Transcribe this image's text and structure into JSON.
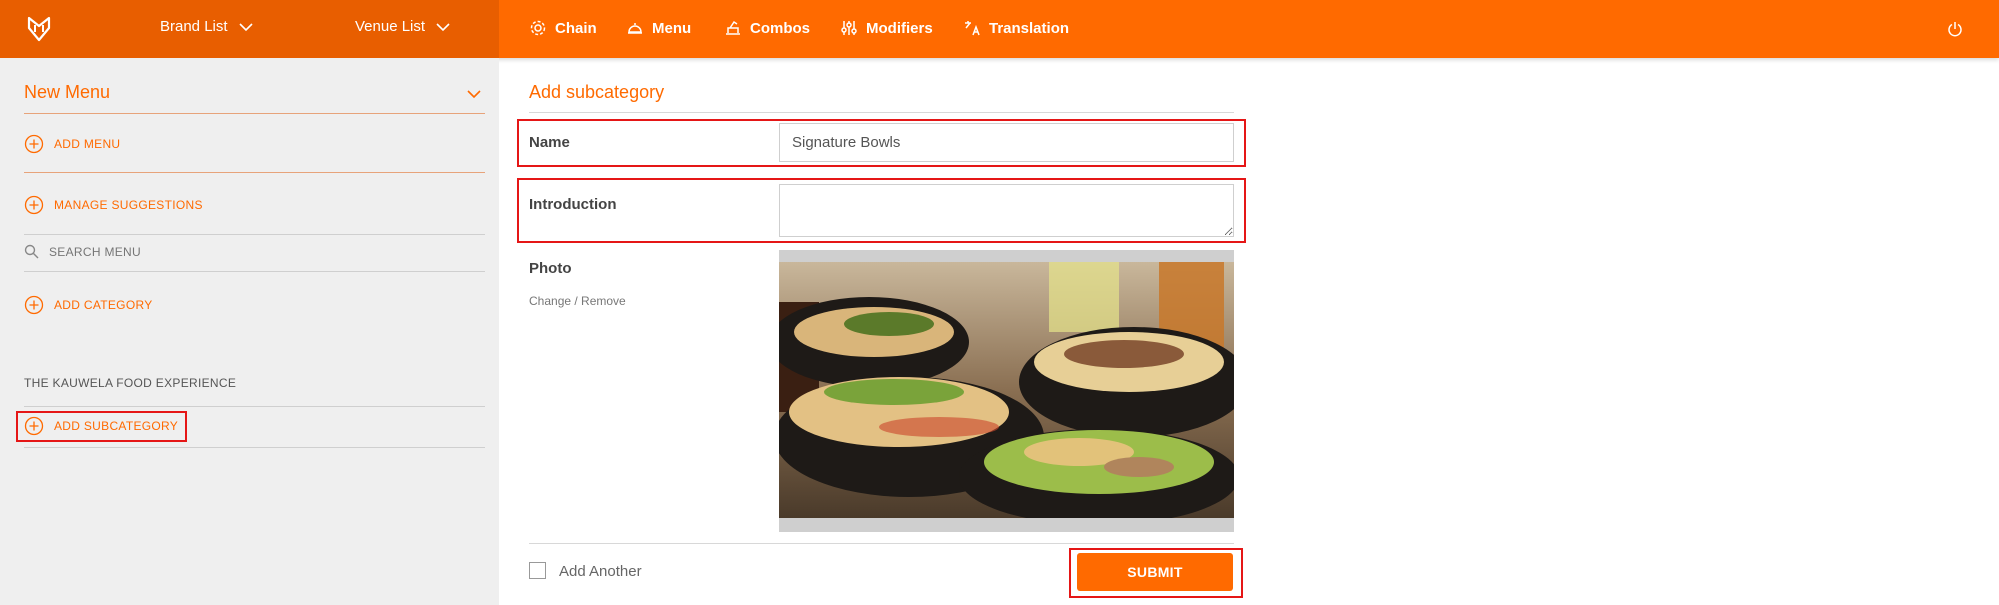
{
  "topbar": {
    "brand_list": "Brand List",
    "venue_list": "Venue List",
    "nav": [
      {
        "label": "Chain",
        "icon": "gear-icon"
      },
      {
        "label": "Menu",
        "icon": "cloche-icon"
      },
      {
        "label": "Combos",
        "icon": "combo-icon"
      },
      {
        "label": "Modifiers",
        "icon": "sliders-icon"
      },
      {
        "label": "Translation",
        "icon": "translate-icon"
      }
    ],
    "accent": "#ff6a00"
  },
  "sidebar": {
    "title": "New Menu",
    "add_menu": "ADD MENU",
    "manage_suggestions": "MANAGE SUGGESTIONS",
    "search_placeholder": "SEARCH MENU",
    "add_category": "ADD CATEGORY",
    "section_title": "THE KAUWELA FOOD EXPERIENCE",
    "add_subcategory": "ADD SUBCATEGORY"
  },
  "form": {
    "title": "Add subcategory",
    "name_label": "Name",
    "name_value": "Signature Bowls",
    "intro_label": "Introduction",
    "intro_value": "",
    "photo_label": "Photo",
    "photo_actions": "Change / Remove",
    "add_another_label": "Add Another",
    "add_another_checked": false,
    "submit_label": "SUBMIT"
  }
}
